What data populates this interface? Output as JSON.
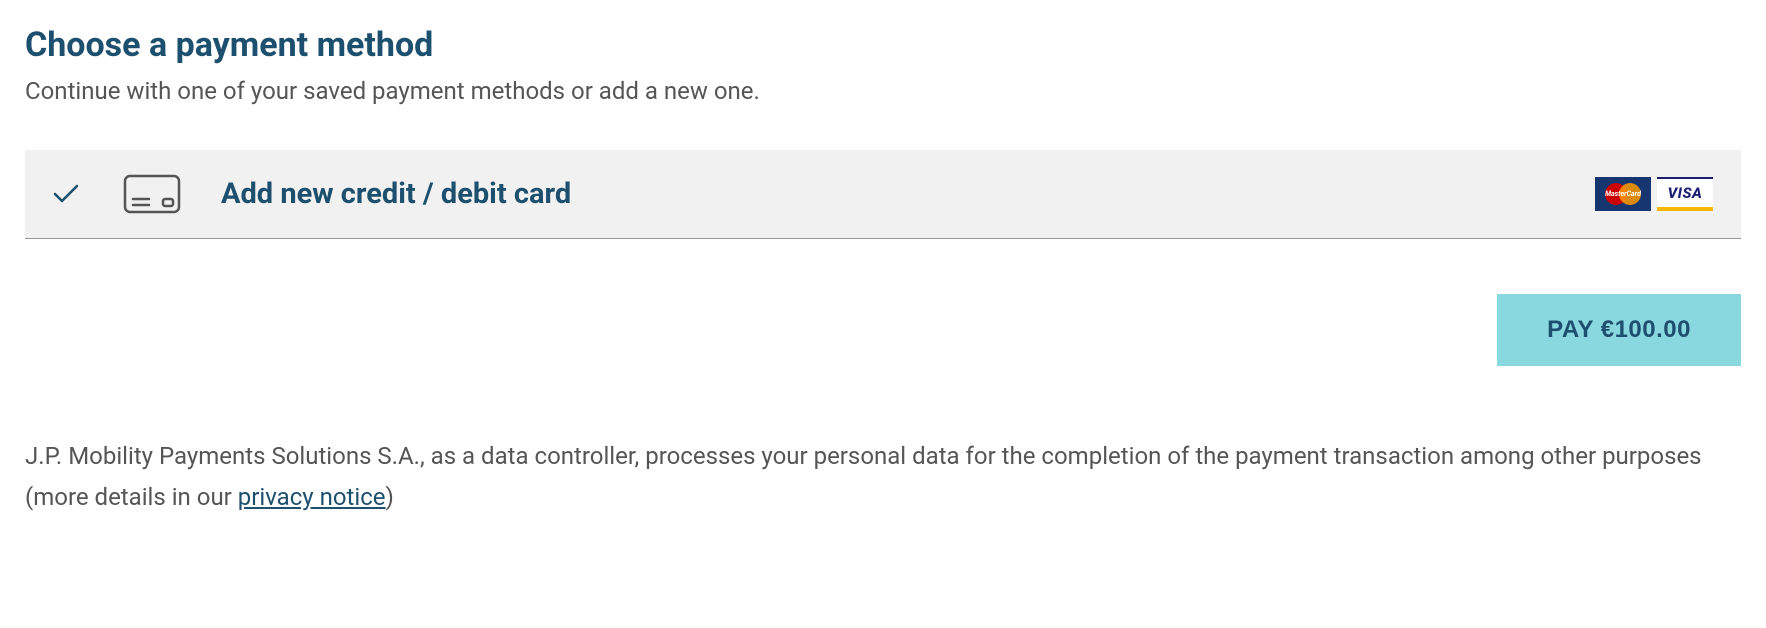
{
  "header": {
    "title": "Choose a payment method",
    "subtitle": "Continue with one of your saved payment methods or add a new one."
  },
  "payment_option": {
    "label": "Add new credit / debit card",
    "selected": true,
    "card_brands": {
      "mastercard": "MasterCard",
      "visa": "VISA"
    }
  },
  "pay_button": {
    "label": "PAY €100.00"
  },
  "legal": {
    "text_before": "J.P. Mobility Payments Solutions S.A., as a data controller, processes your personal data for the completion of the payment transaction among other purposes (more details in our ",
    "link_text": "privacy notice",
    "text_after": ")"
  },
  "colors": {
    "brand_dark": "#1d4f6e",
    "accent": "#89d8df",
    "panel_bg": "#f1f1f1"
  }
}
